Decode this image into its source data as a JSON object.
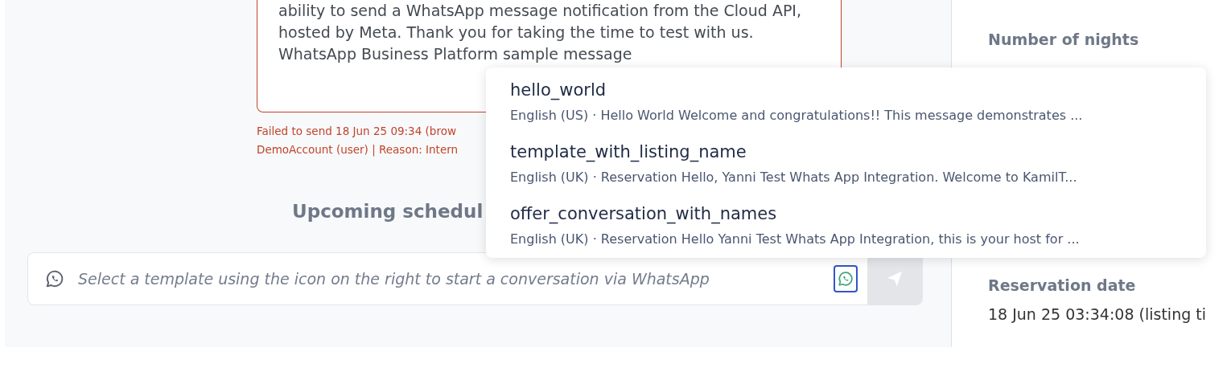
{
  "message": {
    "lines": [
      "ability to send a WhatsApp message notification from the Cloud API,",
      "hosted by Meta. Thank you for taking the time to test with us.",
      "WhatsApp Business Platform sample message"
    ],
    "status_lines": [
      "Failed to send 18 Jun 25 09:34 (brow",
      "DemoAccount (user) | Reason: Intern"
    ]
  },
  "upcoming_heading": "Upcoming schedul",
  "composer": {
    "placeholder": "Select a template using the icon on the right to start a conversation via WhatsApp",
    "send_disabled": true
  },
  "details": [
    {
      "label": "Number of nights"
    },
    {
      "label": "Reservation date",
      "value": "18 Jun 25 03:34:08 (listing ti"
    }
  ],
  "templates": [
    {
      "name": "hello_world",
      "description": "English (US) · Hello World Welcome and congratulations!! This message demonstrates ..."
    },
    {
      "name": "template_with_listing_name",
      "description": "English (UK) · Reservation Hello, Yanni Test Whats App Integration. Welcome to KamilT..."
    },
    {
      "name": "offer_conversation_with_names",
      "description": "English (UK) · Reservation Hello Yanni Test Whats App Integration, this is your host for ..."
    }
  ]
}
